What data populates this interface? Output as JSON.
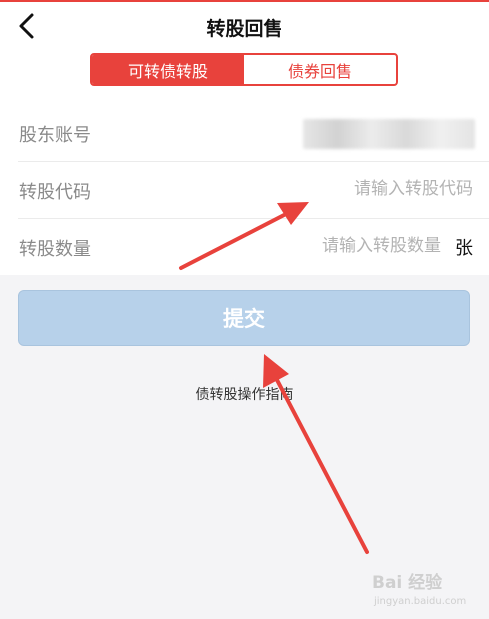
{
  "header": {
    "title": "转股回售",
    "back_icon": "chevron-left-icon"
  },
  "tabs": [
    {
      "label": "可转债转股",
      "active": true
    },
    {
      "label": "债券回售",
      "active": false
    }
  ],
  "form": {
    "account": {
      "label": "股东账号"
    },
    "code": {
      "label": "转股代码",
      "placeholder": "请输入转股代码"
    },
    "quantity": {
      "label": "转股数量",
      "placeholder": "请输入转股数量",
      "unit": "张"
    }
  },
  "submit_label": "提交",
  "guide_link": "债转股操作指南",
  "watermark": {
    "text": "Bai 经验",
    "sub": "jingyan.baidu.com"
  },
  "colors": {
    "accent": "#e8423c",
    "submit_bg": "#b7d1ea",
    "annotation_arrow": "#e8423c"
  }
}
